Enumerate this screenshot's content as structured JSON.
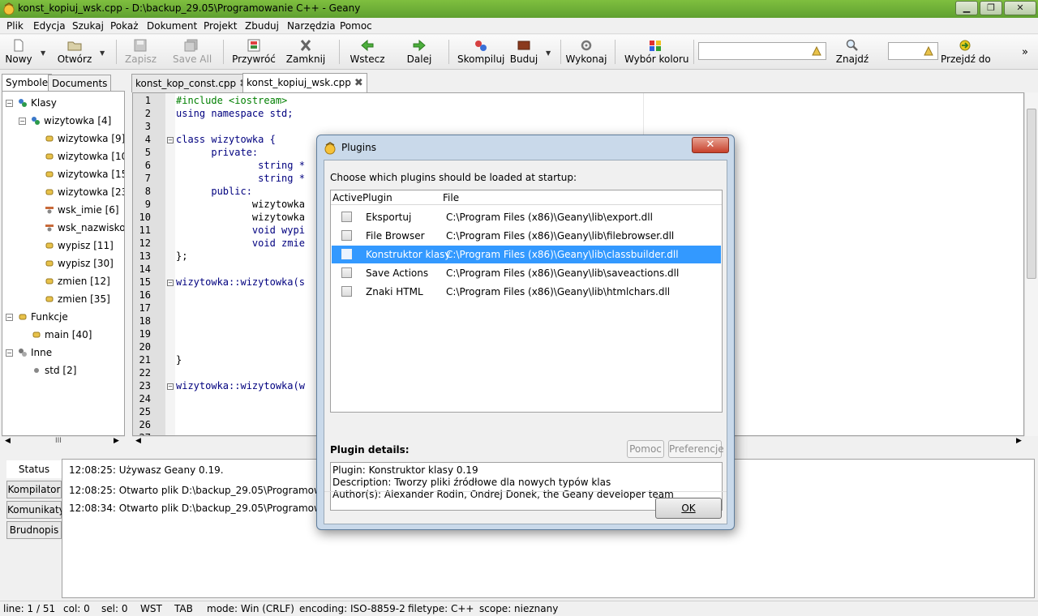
{
  "window": {
    "title": "konst_kopiuj_wsk.cpp - D:\\backup_29.05\\Programowanie C++ - Geany",
    "minimize": "▁",
    "maximize": "❐",
    "close": "✕"
  },
  "menu": [
    "Plik",
    "Edycja",
    "Szukaj",
    "Pokaż",
    "Dokument",
    "Projekt",
    "Zbuduj",
    "Narzędzia",
    "Pomoc"
  ],
  "toolbar": {
    "new": "Nowy",
    "open": "Otwórz",
    "save": "Zapisz",
    "save_all": "Save All",
    "revert": "Przywróć",
    "close": "Zamknij",
    "back": "Wstecz",
    "forward": "Dalej",
    "compile": "Skompiluj",
    "build": "Buduj",
    "run": "Wykonaj",
    "color": "Wybór koloru",
    "find": "Znajdź",
    "goto": "Przejdź do",
    "more": "»"
  },
  "sidebar": {
    "tabs": [
      "Symbole",
      "Documents"
    ],
    "tree": [
      {
        "label": "Klasy"
      },
      {
        "label": "wizytowka [4]"
      },
      {
        "label": "wizytowka [9]"
      },
      {
        "label": "wizytowka [10"
      },
      {
        "label": "wizytowka [15"
      },
      {
        "label": "wizytowka [23"
      },
      {
        "label": "wsk_imie [6]"
      },
      {
        "label": "wsk_nazwisko"
      },
      {
        "label": "wypisz [11]"
      },
      {
        "label": "wypisz [30]"
      },
      {
        "label": "zmien [12]"
      },
      {
        "label": "zmien [35]"
      },
      {
        "label": "Funkcje"
      },
      {
        "label": "main [40]"
      },
      {
        "label": "Inne"
      },
      {
        "label": "std [2]"
      }
    ],
    "scroll_thumb": "III"
  },
  "editor": {
    "tabs": [
      "konst_kop_const.cpp",
      "konst_kopiuj_wsk.cpp"
    ],
    "lines": [
      "#include <iostream>",
      "using namespace std;",
      "",
      "class wizytowka {",
      "      private:",
      "              string *",
      "              string *",
      "      public:",
      "             wizytowka",
      "             wizytowka",
      "             void wypi",
      "             void zmie",
      "};",
      "",
      "wizytowka::wizytowka(s",
      "",
      "",
      "",
      "",
      "",
      "}",
      "",
      "wizytowka::wizytowka(w",
      "",
      "",
      "",
      ""
    ],
    "line_numbers": [
      "1",
      "2",
      "3",
      "4",
      "5",
      "6",
      "7",
      "8",
      "9",
      "10",
      "11",
      "12",
      "13",
      "14",
      "15",
      "16",
      "17",
      "18",
      "19",
      "20",
      "21",
      "22",
      "23",
      "24",
      "25",
      "26",
      "27"
    ]
  },
  "messages": {
    "tabs": [
      "Status",
      "Kompilator",
      "Komunikaty",
      "Brudnopis"
    ],
    "lines": [
      "12:08:25: Używasz Geany 0.19.",
      "12:08:25: Otwarto plik D:\\backup_29.05\\Programowani",
      "12:08:34: Otwarto plik D:\\backup_29.05\\Programowani"
    ]
  },
  "status": {
    "line": "line: 1 / 51",
    "col": "col: 0",
    "sel": "sel: 0",
    "ovr": "WST",
    "indent": "TAB",
    "mode": "mode: Win (CRLF)",
    "encoding": "encoding: ISO-8859-2",
    "filetype": "filetype: C++",
    "scope": "scope: nieznany"
  },
  "dialog": {
    "title": "Plugins",
    "close": "✕",
    "lead": "Choose which plugins should be loaded at startup:",
    "columns": {
      "active": "Active",
      "plugin": "Plugin",
      "file": "File"
    },
    "plugins": [
      {
        "name": "Eksportuj",
        "file": "C:\\Program Files (x86)\\Geany\\lib\\export.dll"
      },
      {
        "name": "File Browser",
        "file": "C:\\Program Files (x86)\\Geany\\lib\\filebrowser.dll"
      },
      {
        "name": "Konstruktor klasy",
        "file": "C:\\Program Files (x86)\\Geany\\lib\\classbuilder.dll"
      },
      {
        "name": "Save Actions",
        "file": "C:\\Program Files (x86)\\Geany\\lib\\saveactions.dll"
      },
      {
        "name": "Znaki HTML",
        "file": "C:\\Program Files (x86)\\Geany\\lib\\htmlchars.dll"
      }
    ],
    "details_label": "Plugin details:",
    "help_button": "Pomoc",
    "prefs_button": "Preferencje",
    "details": [
      "Plugin: Konstruktor klasy 0.19",
      "Description: Tworzy pliki źródłowe dla nowych typów klas",
      "Author(s): Alexander Rodin, Ondrej Donek, the Geany developer team"
    ],
    "ok_button": "OK"
  },
  "colors": {
    "selection": "#3399ff",
    "title_bar": "#6eb03a"
  }
}
